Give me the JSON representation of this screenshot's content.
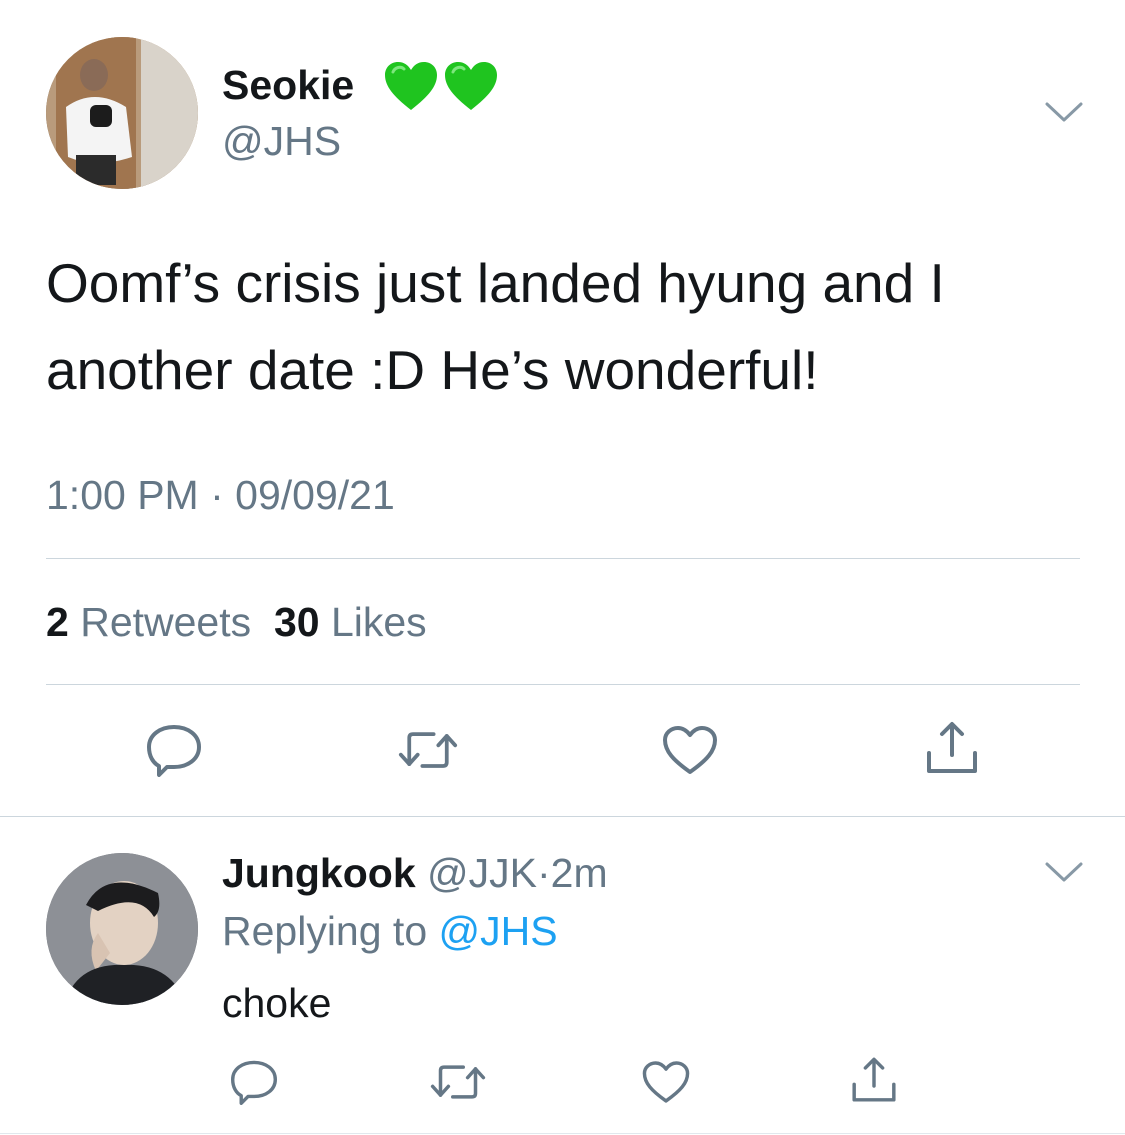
{
  "tweet": {
    "author": {
      "display_name": "Seokie",
      "handle": "@JHS",
      "name_emoji": [
        "green-heart-icon",
        "green-heart-icon"
      ]
    },
    "text_lines": [
      "Oomf’s crisis just landed hyung and I",
      "another date :D He’s wonderful!"
    ],
    "time": "1:00 PM",
    "separator": "·",
    "date": "09/09/21",
    "stats": {
      "retweets_count": "2",
      "retweets_label": "Retweets",
      "likes_count": "30",
      "likes_label": "Likes"
    },
    "actions": [
      "reply-icon",
      "retweet-icon",
      "like-icon",
      "share-icon"
    ]
  },
  "reply": {
    "author": {
      "display_name": "Jungkook",
      "handle": "@JJK",
      "separator": "·",
      "age": "2m"
    },
    "replying_to_label": "Replying to",
    "replying_to_handle": "@JHS",
    "text": "choke",
    "actions": [
      "reply-icon",
      "retweet-icon",
      "like-icon",
      "share-icon"
    ]
  },
  "colors": {
    "text_primary": "#14171a",
    "text_secondary": "#657786",
    "link": "#1da1f2",
    "divider": "#ccd6dd",
    "heart_green": "#1fc41f"
  }
}
